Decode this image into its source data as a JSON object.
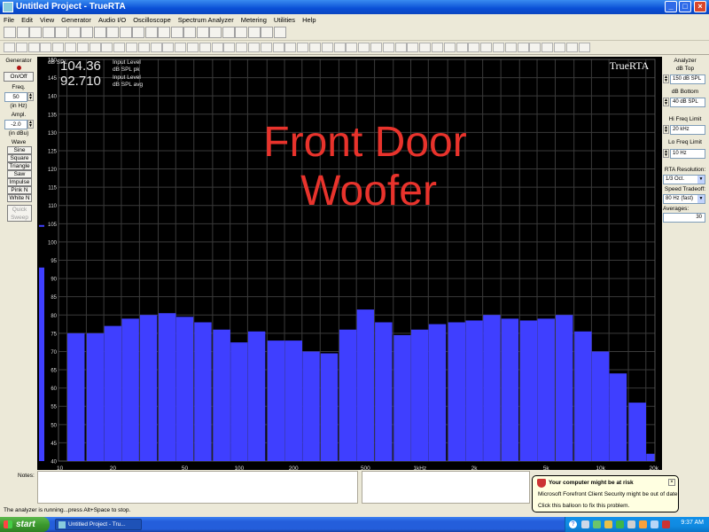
{
  "window": {
    "title": "Untitled Project - TrueRTA"
  },
  "menu": [
    "File",
    "Edit",
    "View",
    "Generator",
    "Audio I/O",
    "Oscilloscope",
    "Spectrum Analyzer",
    "Metering",
    "Utilities",
    "Help"
  ],
  "generator": {
    "title": "Generator",
    "onoff_label": "On/Off",
    "freq_label": "Freq.",
    "freq_value": "50",
    "freq_unit": "(in Hz)",
    "ampl_label": "Ampl.",
    "ampl_value": "-2.0",
    "ampl_unit": "(in dBu)",
    "wave_label": "Wave",
    "waves": [
      "Sine",
      "Square",
      "Triangle",
      "Saw",
      "Impulse",
      "Pink N",
      "White N"
    ],
    "quick_sweep": "Quick Sweep"
  },
  "readout": {
    "pk_value": "104.36",
    "pk_label1": "Input Level",
    "pk_label2": "dB SPL pk",
    "avg_value": "92.710",
    "avg_label1": "Input Level",
    "avg_label2": "dB SPL avg"
  },
  "brand": "TrueRTA",
  "overlay_text": [
    "Front Door",
    "Woofer"
  ],
  "analyzer": {
    "title": "Analyzer",
    "db_top_label": "dB Top",
    "db_top_value": "150 dB SPL",
    "db_bottom_label": "dB Bottom",
    "db_bottom_value": "40 dB SPL",
    "hi_freq_label": "Hi Freq Limit",
    "hi_freq_value": "20 kHz",
    "lo_freq_label": "Lo Freq Limit",
    "lo_freq_value": "10 Hz",
    "rta_res_label": "RTA Resolution:",
    "rta_res_value": "1/3 Oct.",
    "speed_label": "Speed Tradeoff:",
    "speed_value": "80 Hz (fast)",
    "averages_label": "Averages:",
    "averages_value": "30"
  },
  "notes_label": "Notes:",
  "status_text": "The analyzer is running...press Alt+Space to stop.",
  "balloon": {
    "title": "Your computer might be at risk",
    "line1": "Microsoft Forefront Client Security might be out of date",
    "line2": "Click this balloon to fix this problem."
  },
  "taskbar": {
    "start_label": "start",
    "task_label": "Untitled Project - Tru...",
    "clock": "9:37 AM"
  },
  "colors": {
    "bar": "#3f3fff",
    "grid": "#3a3a3a",
    "overlay_text": "#e8332c",
    "background": "#000000"
  },
  "chart_data": {
    "type": "bar",
    "ylabel": "dB SPL",
    "ylim": [
      40,
      150
    ],
    "y_ticks": [
      150,
      145,
      140,
      135,
      130,
      125,
      120,
      115,
      110,
      105,
      100,
      95,
      90,
      85,
      80,
      75,
      70,
      65,
      60,
      55,
      50,
      45,
      40
    ],
    "x_scale": "log",
    "xlim": [
      10,
      20000
    ],
    "x_ticks": [
      {
        "value": 10,
        "label": "10"
      },
      {
        "value": 20,
        "label": "20"
      },
      {
        "value": 50,
        "label": "50"
      },
      {
        "value": 100,
        "label": "100"
      },
      {
        "value": 200,
        "label": "200"
      },
      {
        "value": 500,
        "label": "500"
      },
      {
        "value": 1000,
        "label": "1kHz"
      },
      {
        "value": 2000,
        "label": "2k"
      },
      {
        "value": 5000,
        "label": "5k"
      },
      {
        "value": 10000,
        "label": "10k"
      },
      {
        "value": 20000,
        "label": "20k"
      }
    ],
    "wideband_level": 93,
    "bands": [
      12.5,
      16,
      20,
      25,
      31.5,
      40,
      50,
      63,
      80,
      100,
      125,
      160,
      200,
      250,
      315,
      400,
      500,
      630,
      800,
      1000,
      1250,
      1600,
      2000,
      2500,
      3150,
      4000,
      5000,
      6300,
      8000,
      10000,
      12500,
      16000,
      20000
    ],
    "values": [
      75,
      75,
      77,
      79,
      80,
      80.5,
      79.5,
      78,
      76,
      72.5,
      75.5,
      73,
      73,
      70,
      69.5,
      76,
      81.5,
      78,
      74.5,
      76,
      77.5,
      78,
      78.5,
      80,
      79,
      78.5,
      79,
      80,
      75.5,
      70,
      64,
      56,
      42
    ]
  }
}
